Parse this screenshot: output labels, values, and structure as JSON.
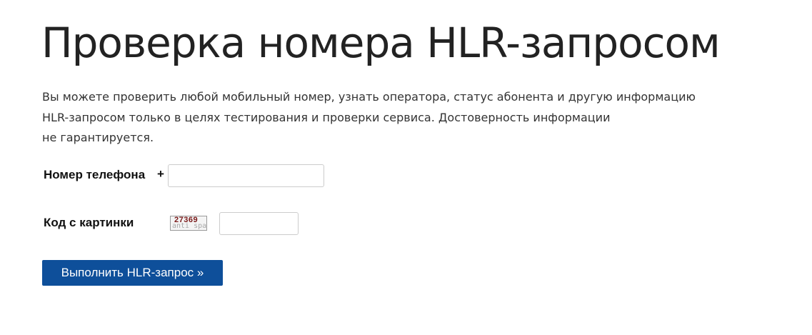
{
  "page": {
    "title": "Проверка номера HLR-запросом",
    "description_lines": [
      "Вы можете проверить любой мобильный номер, узнать оператора, статус абонента и другую информацию",
      "HLR-запросом только в целях тестирования и проверки сервиса. Достоверность информации",
      "не гарантируется."
    ]
  },
  "form": {
    "phone_label": "Номер телефона",
    "phone_prefix": "+",
    "phone_value": "",
    "captcha_label": "Код с картинки",
    "captcha_code": "27369",
    "captcha_watermark": "anti spam",
    "captcha_value": "",
    "submit_label": "Выполнить HLR-запрос »"
  },
  "colors": {
    "button_background": "#0e4f9a",
    "button_text": "#ffffff",
    "title_text": "#222222"
  }
}
